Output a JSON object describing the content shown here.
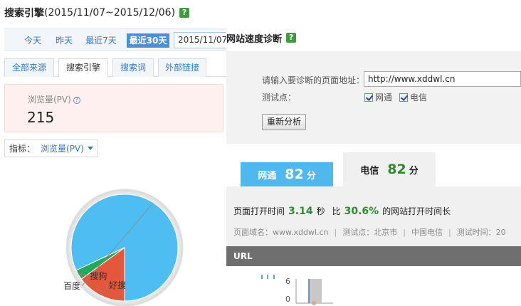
{
  "left": {
    "title": "搜索引擎",
    "date_range": "(2015/11/07~2015/12/06)",
    "help": "?",
    "periods": [
      {
        "label": "今天",
        "active": false
      },
      {
        "label": "昨天",
        "active": false
      },
      {
        "label": "最近7天",
        "active": false
      },
      {
        "label": "最近30天",
        "active": true
      }
    ],
    "date_input_value": "2015/11/07",
    "tabs": [
      {
        "label": "全部来源",
        "active": false
      },
      {
        "label": "搜索引擎",
        "active": true
      },
      {
        "label": "搜索词",
        "active": false
      },
      {
        "label": "外部链接",
        "active": false
      }
    ],
    "metric": {
      "label": "浏览量(PV)",
      "help": "?",
      "value": "215"
    },
    "indicator": {
      "label": "指标：",
      "value": "浏览量(PV)"
    }
  },
  "chart_data": {
    "type": "pie",
    "title": "",
    "slices": [
      {
        "label": "百度",
        "value": 82,
        "color": "#4ebdf2"
      },
      {
        "label": "好搜",
        "value": 15,
        "color": "#e3573c"
      },
      {
        "label": "搜狗",
        "value": 3,
        "color": "#22a95a"
      }
    ]
  },
  "right": {
    "title": "网站速度诊断",
    "help": "?",
    "url_label": "请输入要诊断的页面地址：",
    "url_value": "http://www.xddwl.cn",
    "test_point_label": "测试点：",
    "checkboxes": [
      {
        "label": "网通",
        "checked": true
      },
      {
        "label": "电信",
        "checked": true
      }
    ],
    "reanalyze_button": "重新分析",
    "scores": [
      {
        "name": "网通",
        "score": "82",
        "unit": "分"
      },
      {
        "name": "电信",
        "score": "82",
        "unit": "分"
      }
    ],
    "load": {
      "prefix": "页面打开时间",
      "seconds": "3.14",
      "sec_unit": "秒",
      "compare_prefix": "比",
      "percent": "30.6%",
      "suffix": "的网站打开时间长"
    },
    "meta": {
      "domain": "页面域名：www.xddwl.cn",
      "point": "测试点：北京市",
      "isp": "中国电信",
      "time": "测试时间：20"
    },
    "url_header": "URL",
    "mini_chart": {
      "y_top": "6",
      "y_bottom": "0"
    }
  }
}
